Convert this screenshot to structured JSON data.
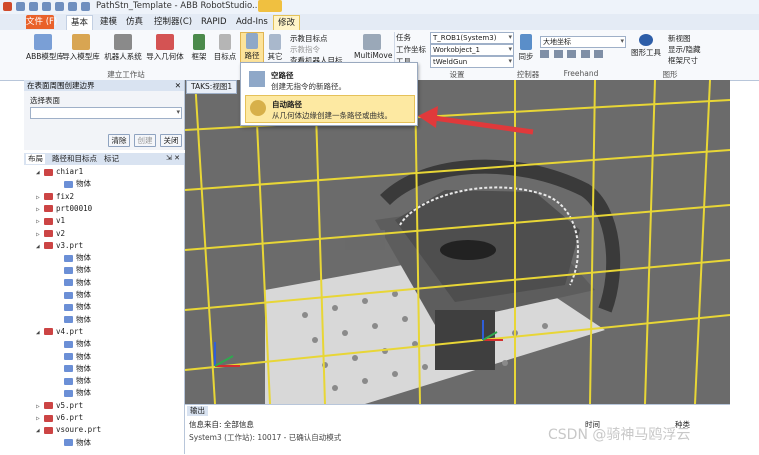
{
  "window": {
    "title": "PathStn_Template - ABB RobotStudio...",
    "context_tab": "修改"
  },
  "menu": {
    "tabs": [
      "文件 (F)",
      "基本",
      "建模",
      "仿真",
      "控制器(C)",
      "RAPID",
      "Add-Ins",
      "修改"
    ]
  },
  "ribbon": {
    "buttons": {
      "abb_library": "ABB模型库",
      "import_library": "导入模型库",
      "robot_system": "机器人系统",
      "import_geometry": "导入几何体",
      "frame": "框架",
      "target": "目标点",
      "path": "路径",
      "other": "其它",
      "teach_target": "示教目标点",
      "teach_instruction": "示教指令",
      "view_robot_target": "查看机器人目标",
      "multimove": "MultiMove",
      "sync": "同步",
      "graphics_tools": "图形工具",
      "new_view": "新视图",
      "show_hide": "显示/隐藏",
      "frame_size": "框架尺寸"
    },
    "settings": {
      "task_label": "任务",
      "workobject_label": "工作坐标",
      "tool_label": "工具",
      "task_value": "T_ROB1(System3)",
      "workobject_value": "Workobject_1",
      "tool_value": "tWeldGun",
      "coord_value": "大地坐标"
    },
    "groups": {
      "build_station": "建立工作站",
      "settings": "设置",
      "controller": "控制器",
      "freehand": "Freehand",
      "graphics": "图形"
    }
  },
  "dropdown": {
    "items": [
      {
        "title": "空路径",
        "desc": "创建无指令的新路径。"
      },
      {
        "title": "自动路径",
        "desc": "从几何体边缘创建一条路径或曲线。"
      }
    ]
  },
  "autopath_panel": {
    "header": "在表面周围创建边界",
    "select_label": "选择表面",
    "clear_label": "清除",
    "create_label": "创建",
    "close_label": "关闭"
  },
  "layout_panel": {
    "tabs": [
      "布局",
      "路径和目标点",
      "标记"
    ],
    "tree": [
      {
        "label": "chiar1",
        "level": 1,
        "expanded": true
      },
      {
        "label": "物体",
        "level": 2
      },
      {
        "label": "fix2",
        "level": 1,
        "expanded": false
      },
      {
        "label": "prt00010",
        "level": 1,
        "expanded": false
      },
      {
        "label": "v1",
        "level": 1,
        "expanded": false
      },
      {
        "label": "v2",
        "level": 1,
        "expanded": false
      },
      {
        "label": "v3.prt",
        "level": 1,
        "expanded": true
      },
      {
        "label": "物体",
        "level": 2
      },
      {
        "label": "物体",
        "level": 2
      },
      {
        "label": "物体",
        "level": 2
      },
      {
        "label": "物体",
        "level": 2
      },
      {
        "label": "物体",
        "level": 2
      },
      {
        "label": "物体",
        "level": 2
      },
      {
        "label": "v4.prt",
        "level": 1,
        "expanded": true
      },
      {
        "label": "物体",
        "level": 2
      },
      {
        "label": "物体",
        "level": 2
      },
      {
        "label": "物体",
        "level": 2
      },
      {
        "label": "物体",
        "level": 2
      },
      {
        "label": "物体",
        "level": 2
      },
      {
        "label": "v5.prt",
        "level": 1,
        "expanded": false
      },
      {
        "label": "v6.prt",
        "level": 1,
        "expanded": false
      },
      {
        "label": "vsoure.prt",
        "level": 1,
        "expanded": true
      },
      {
        "label": "物体",
        "level": 2
      }
    ]
  },
  "viewport": {
    "tab_label": "TAKS:视图1"
  },
  "output": {
    "tab_label": "输出",
    "filter_label": "信息来自: 全部信息",
    "line1": "System3 (工作站): 10017 - 已确认自动模式",
    "col_time": "时间",
    "col_category": "种类"
  },
  "watermark": "CSDN @骑神马鸥浮云",
  "colors": {
    "file_tab": "#e9612a",
    "highlight": "#fde9a2",
    "arrow": "#e0393b",
    "fence": "#e8d636",
    "table": "#d8d8d8"
  }
}
